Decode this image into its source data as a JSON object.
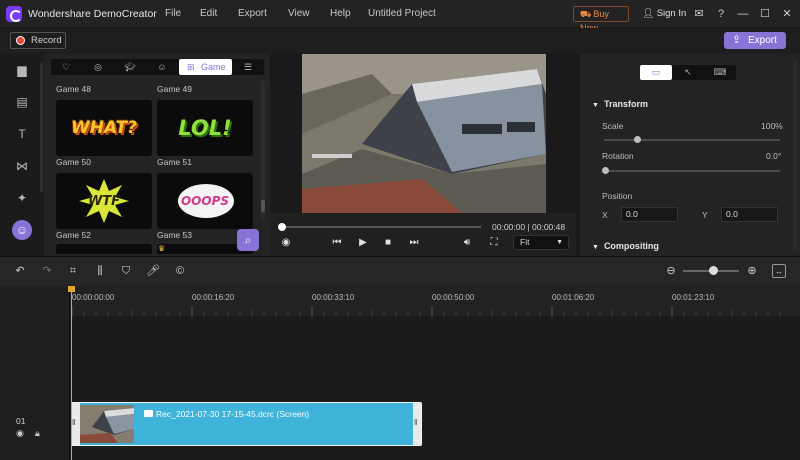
{
  "titlebar": {
    "app_title": "Wondershare DemoCreator",
    "menu": [
      "File",
      "Edit",
      "Export",
      "View",
      "Help"
    ],
    "project_title": "Untitled Project",
    "buy_label": "Buy Now",
    "signin_label": "Sign In"
  },
  "toolbar": {
    "record_label": "Record",
    "export_label": "Export"
  },
  "library": {
    "categories": [
      "heart",
      "vr",
      "education",
      "smile",
      "Game",
      "menu"
    ],
    "active_category": "Game",
    "items": [
      {
        "label": "Game 48",
        "sticker": ""
      },
      {
        "label": "Game 49",
        "sticker": ""
      },
      {
        "label": "Game 50",
        "sticker": "WHAT?"
      },
      {
        "label": "Game 51",
        "sticker": "LOL!"
      },
      {
        "label": "Game 52",
        "sticker": "WTF"
      },
      {
        "label": "Game 53",
        "sticker": "OOOPS"
      }
    ]
  },
  "preview": {
    "time": "00:00:00 | 00:00:48",
    "fit_label": "Fit",
    "progress": 0.0
  },
  "properties": {
    "transform_label": "Transform",
    "scale_label": "Scale",
    "scale_value": "100%",
    "rotation_label": "Rotation",
    "rotation_value": "0.0°",
    "position_label": "Position",
    "x_label": "X",
    "x_value": "0.0",
    "y_label": "Y",
    "y_value": "0.0",
    "compositing_label": "Compositing"
  },
  "timeline": {
    "ruler": [
      "00:00:00:00",
      "00:00:16:20",
      "00:00:33:10",
      "00:00:50:00",
      "00:01:06:20",
      "00:01:23:10"
    ],
    "track_number": "01",
    "clip_name": "Rec_2021-07-30 17-15-45.dcrc (Screen)"
  },
  "colors": {
    "accent": "#8a73d6",
    "clip": "#3fb3da",
    "playhead": "#e0a72a",
    "record_dot": "#e8463b",
    "buy": "#f08a4b"
  }
}
